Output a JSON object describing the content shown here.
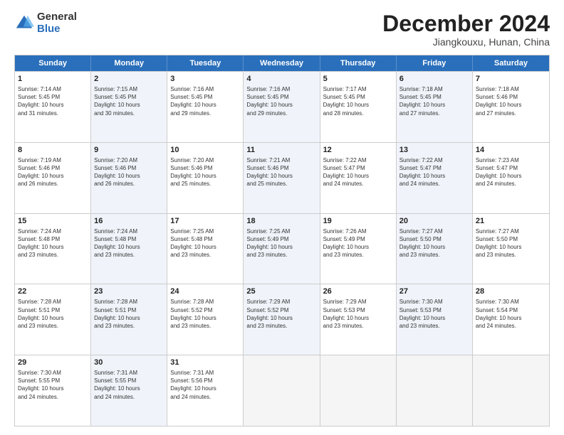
{
  "logo": {
    "general": "General",
    "blue": "Blue"
  },
  "header": {
    "month": "December 2024",
    "location": "Jiangkouxu, Hunan, China"
  },
  "weekdays": [
    "Sunday",
    "Monday",
    "Tuesday",
    "Wednesday",
    "Thursday",
    "Friday",
    "Saturday"
  ],
  "weeks": [
    [
      {
        "day": "1",
        "lines": [
          "Sunrise: 7:14 AM",
          "Sunset: 5:45 PM",
          "Daylight: 10 hours",
          "and 31 minutes."
        ],
        "empty": false,
        "alt": false
      },
      {
        "day": "2",
        "lines": [
          "Sunrise: 7:15 AM",
          "Sunset: 5:45 PM",
          "Daylight: 10 hours",
          "and 30 minutes."
        ],
        "empty": false,
        "alt": true
      },
      {
        "day": "3",
        "lines": [
          "Sunrise: 7:16 AM",
          "Sunset: 5:45 PM",
          "Daylight: 10 hours",
          "and 29 minutes."
        ],
        "empty": false,
        "alt": false
      },
      {
        "day": "4",
        "lines": [
          "Sunrise: 7:16 AM",
          "Sunset: 5:45 PM",
          "Daylight: 10 hours",
          "and 29 minutes."
        ],
        "empty": false,
        "alt": true
      },
      {
        "day": "5",
        "lines": [
          "Sunrise: 7:17 AM",
          "Sunset: 5:45 PM",
          "Daylight: 10 hours",
          "and 28 minutes."
        ],
        "empty": false,
        "alt": false
      },
      {
        "day": "6",
        "lines": [
          "Sunrise: 7:18 AM",
          "Sunset: 5:45 PM",
          "Daylight: 10 hours",
          "and 27 minutes."
        ],
        "empty": false,
        "alt": true
      },
      {
        "day": "7",
        "lines": [
          "Sunrise: 7:18 AM",
          "Sunset: 5:46 PM",
          "Daylight: 10 hours",
          "and 27 minutes."
        ],
        "empty": false,
        "alt": false
      }
    ],
    [
      {
        "day": "8",
        "lines": [
          "Sunrise: 7:19 AM",
          "Sunset: 5:46 PM",
          "Daylight: 10 hours",
          "and 26 minutes."
        ],
        "empty": false,
        "alt": false
      },
      {
        "day": "9",
        "lines": [
          "Sunrise: 7:20 AM",
          "Sunset: 5:46 PM",
          "Daylight: 10 hours",
          "and 26 minutes."
        ],
        "empty": false,
        "alt": true
      },
      {
        "day": "10",
        "lines": [
          "Sunrise: 7:20 AM",
          "Sunset: 5:46 PM",
          "Daylight: 10 hours",
          "and 25 minutes."
        ],
        "empty": false,
        "alt": false
      },
      {
        "day": "11",
        "lines": [
          "Sunrise: 7:21 AM",
          "Sunset: 5:46 PM",
          "Daylight: 10 hours",
          "and 25 minutes."
        ],
        "empty": false,
        "alt": true
      },
      {
        "day": "12",
        "lines": [
          "Sunrise: 7:22 AM",
          "Sunset: 5:47 PM",
          "Daylight: 10 hours",
          "and 24 minutes."
        ],
        "empty": false,
        "alt": false
      },
      {
        "day": "13",
        "lines": [
          "Sunrise: 7:22 AM",
          "Sunset: 5:47 PM",
          "Daylight: 10 hours",
          "and 24 minutes."
        ],
        "empty": false,
        "alt": true
      },
      {
        "day": "14",
        "lines": [
          "Sunrise: 7:23 AM",
          "Sunset: 5:47 PM",
          "Daylight: 10 hours",
          "and 24 minutes."
        ],
        "empty": false,
        "alt": false
      }
    ],
    [
      {
        "day": "15",
        "lines": [
          "Sunrise: 7:24 AM",
          "Sunset: 5:48 PM",
          "Daylight: 10 hours",
          "and 23 minutes."
        ],
        "empty": false,
        "alt": false
      },
      {
        "day": "16",
        "lines": [
          "Sunrise: 7:24 AM",
          "Sunset: 5:48 PM",
          "Daylight: 10 hours",
          "and 23 minutes."
        ],
        "empty": false,
        "alt": true
      },
      {
        "day": "17",
        "lines": [
          "Sunrise: 7:25 AM",
          "Sunset: 5:48 PM",
          "Daylight: 10 hours",
          "and 23 minutes."
        ],
        "empty": false,
        "alt": false
      },
      {
        "day": "18",
        "lines": [
          "Sunrise: 7:25 AM",
          "Sunset: 5:49 PM",
          "Daylight: 10 hours",
          "and 23 minutes."
        ],
        "empty": false,
        "alt": true
      },
      {
        "day": "19",
        "lines": [
          "Sunrise: 7:26 AM",
          "Sunset: 5:49 PM",
          "Daylight: 10 hours",
          "and 23 minutes."
        ],
        "empty": false,
        "alt": false
      },
      {
        "day": "20",
        "lines": [
          "Sunrise: 7:27 AM",
          "Sunset: 5:50 PM",
          "Daylight: 10 hours",
          "and 23 minutes."
        ],
        "empty": false,
        "alt": true
      },
      {
        "day": "21",
        "lines": [
          "Sunrise: 7:27 AM",
          "Sunset: 5:50 PM",
          "Daylight: 10 hours",
          "and 23 minutes."
        ],
        "empty": false,
        "alt": false
      }
    ],
    [
      {
        "day": "22",
        "lines": [
          "Sunrise: 7:28 AM",
          "Sunset: 5:51 PM",
          "Daylight: 10 hours",
          "and 23 minutes."
        ],
        "empty": false,
        "alt": false
      },
      {
        "day": "23",
        "lines": [
          "Sunrise: 7:28 AM",
          "Sunset: 5:51 PM",
          "Daylight: 10 hours",
          "and 23 minutes."
        ],
        "empty": false,
        "alt": true
      },
      {
        "day": "24",
        "lines": [
          "Sunrise: 7:28 AM",
          "Sunset: 5:52 PM",
          "Daylight: 10 hours",
          "and 23 minutes."
        ],
        "empty": false,
        "alt": false
      },
      {
        "day": "25",
        "lines": [
          "Sunrise: 7:29 AM",
          "Sunset: 5:52 PM",
          "Daylight: 10 hours",
          "and 23 minutes."
        ],
        "empty": false,
        "alt": true
      },
      {
        "day": "26",
        "lines": [
          "Sunrise: 7:29 AM",
          "Sunset: 5:53 PM",
          "Daylight: 10 hours",
          "and 23 minutes."
        ],
        "empty": false,
        "alt": false
      },
      {
        "day": "27",
        "lines": [
          "Sunrise: 7:30 AM",
          "Sunset: 5:53 PM",
          "Daylight: 10 hours",
          "and 23 minutes."
        ],
        "empty": false,
        "alt": true
      },
      {
        "day": "28",
        "lines": [
          "Sunrise: 7:30 AM",
          "Sunset: 5:54 PM",
          "Daylight: 10 hours",
          "and 24 minutes."
        ],
        "empty": false,
        "alt": false
      }
    ],
    [
      {
        "day": "29",
        "lines": [
          "Sunrise: 7:30 AM",
          "Sunset: 5:55 PM",
          "Daylight: 10 hours",
          "and 24 minutes."
        ],
        "empty": false,
        "alt": false
      },
      {
        "day": "30",
        "lines": [
          "Sunrise: 7:31 AM",
          "Sunset: 5:55 PM",
          "Daylight: 10 hours",
          "and 24 minutes."
        ],
        "empty": false,
        "alt": true
      },
      {
        "day": "31",
        "lines": [
          "Sunrise: 7:31 AM",
          "Sunset: 5:56 PM",
          "Daylight: 10 hours",
          "and 24 minutes."
        ],
        "empty": false,
        "alt": false
      },
      {
        "day": "",
        "lines": [],
        "empty": true,
        "alt": true
      },
      {
        "day": "",
        "lines": [],
        "empty": true,
        "alt": false
      },
      {
        "day": "",
        "lines": [],
        "empty": true,
        "alt": true
      },
      {
        "day": "",
        "lines": [],
        "empty": true,
        "alt": false
      }
    ]
  ]
}
